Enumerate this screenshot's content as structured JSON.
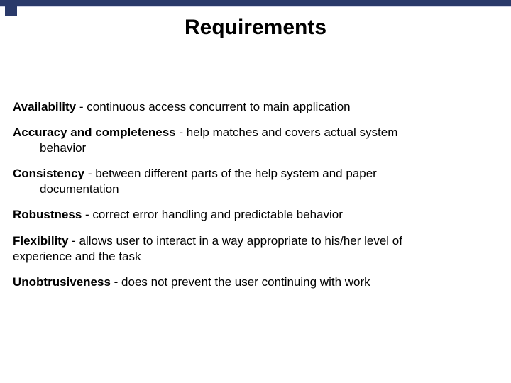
{
  "title": "Requirements",
  "items": [
    {
      "term": "Availability",
      "sep": " - ",
      "desc": "continuous access concurrent to main application",
      "wrap": null
    },
    {
      "term": "Accuracy and completeness",
      "sep": " - ",
      "desc": "help matches and covers actual system",
      "wrap": "behavior"
    },
    {
      "term": "Consistency",
      "sep": " - ",
      "desc": "between different parts of the help system and paper",
      "wrap": "documentation"
    },
    {
      "term": "Robustness",
      "sep": " - ",
      "desc": "correct error handling and predictable behavior",
      "wrap": null
    },
    {
      "term": "Flexibility",
      "sep": " - ",
      "desc": "allows user to interact in a way appropriate to his/her level of",
      "wrap_noindent": "experience and the task"
    },
    {
      "term": "Unobtrusiveness",
      "sep": " - ",
      "desc": "does not prevent the user continuing with work",
      "wrap": null
    }
  ]
}
